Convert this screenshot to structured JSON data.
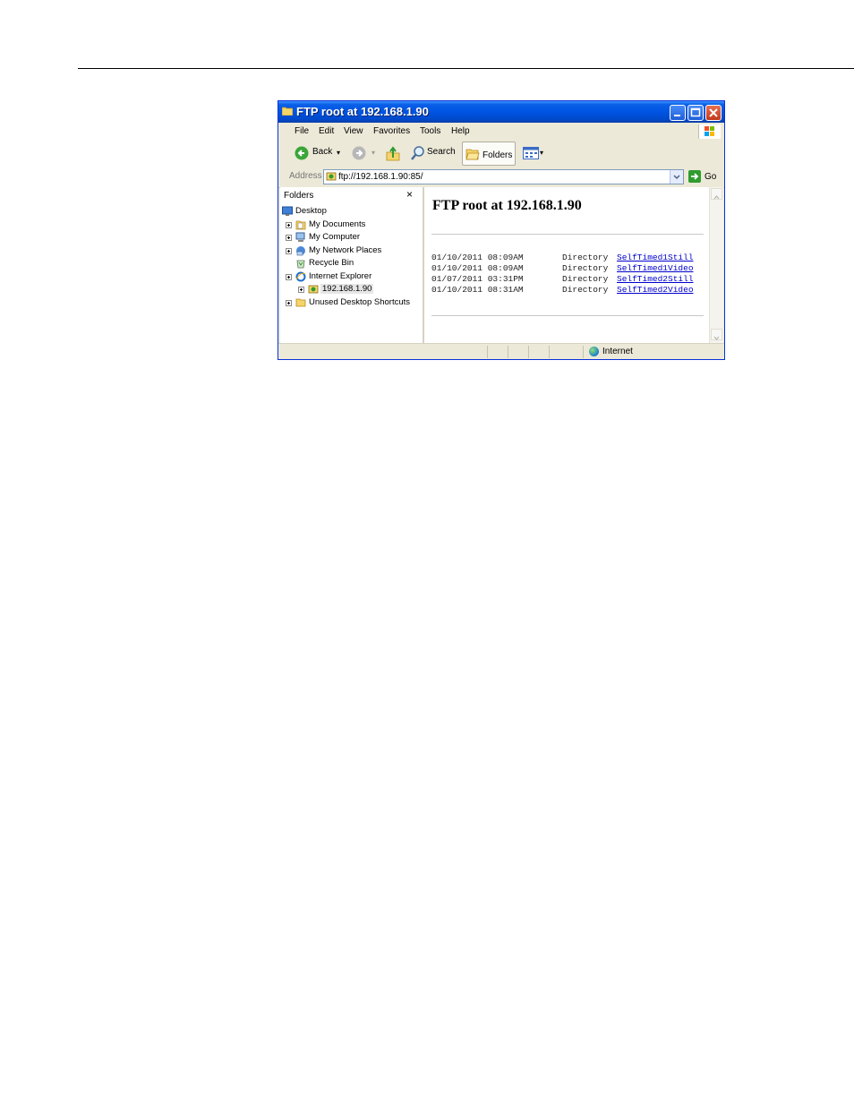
{
  "window": {
    "title": "FTP root at 192.168.1.90",
    "controls": [
      "minimize-icon",
      "maximize-icon",
      "close-icon"
    ]
  },
  "menu": [
    "File",
    "Edit",
    "View",
    "Favorites",
    "Tools",
    "Help"
  ],
  "toolbar": {
    "back": "Back",
    "search": "Search",
    "folders": "Folders"
  },
  "address": {
    "label": "Address",
    "value": "ftp://192.168.1.90:85/",
    "go": "Go"
  },
  "folders_pane": {
    "header": "Folders",
    "close": "×",
    "items": [
      {
        "label": "Desktop"
      },
      {
        "label": "My Documents"
      },
      {
        "label": "My Computer"
      },
      {
        "label": "My Network Places"
      },
      {
        "label": "Recycle Bin"
      },
      {
        "label": "Internet Explorer"
      },
      {
        "label": "192.168.1.90"
      },
      {
        "label": "Unused Desktop Shortcuts"
      }
    ]
  },
  "content": {
    "heading": "FTP root at 192.168.1.90",
    "entries": [
      {
        "datetime": "01/10/2011 08:09AM",
        "kind": "Directory",
        "name": "SelfTimed1Still"
      },
      {
        "datetime": "01/10/2011 08:09AM",
        "kind": "Directory",
        "name": "SelfTimed1Video"
      },
      {
        "datetime": "01/07/2011 03:31PM",
        "kind": "Directory",
        "name": "SelfTimed2Still"
      },
      {
        "datetime": "01/10/2011 08:31AM",
        "kind": "Directory",
        "name": "SelfTimed2Video"
      }
    ]
  },
  "status": {
    "zone": "Internet"
  },
  "colors": {
    "titlebar": "#0054e3",
    "chrome": "#ece9d8",
    "link": "#0000cc"
  }
}
